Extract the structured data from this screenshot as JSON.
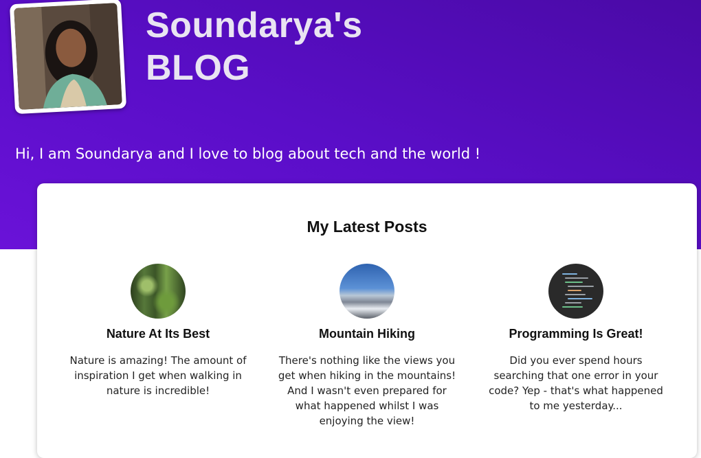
{
  "header": {
    "title_line1": "Soundarya's",
    "title_line2": "BLOG",
    "intro": "Hi, I am Soundarya and I love to blog about tech and the world !",
    "hero_color": "#5a0ec8"
  },
  "latest": {
    "heading": "My Latest Posts",
    "posts": [
      {
        "title": "Nature At Its Best",
        "excerpt": "Nature is amazing! The amount of inspiration I get when walking in nature is incredible!",
        "image": "forest-photo"
      },
      {
        "title": "Mountain Hiking",
        "excerpt": "There's nothing like the views you get when hiking in the mountains! And I wasn't even prepared for what happened whilst I was enjoying the view!",
        "image": "mountain-photo"
      },
      {
        "title": "Programming Is Great!",
        "excerpt": "Did you ever spend hours searching that one error in your code? Yep - that's what happened to me yesterday...",
        "image": "code-screenshot"
      }
    ]
  }
}
